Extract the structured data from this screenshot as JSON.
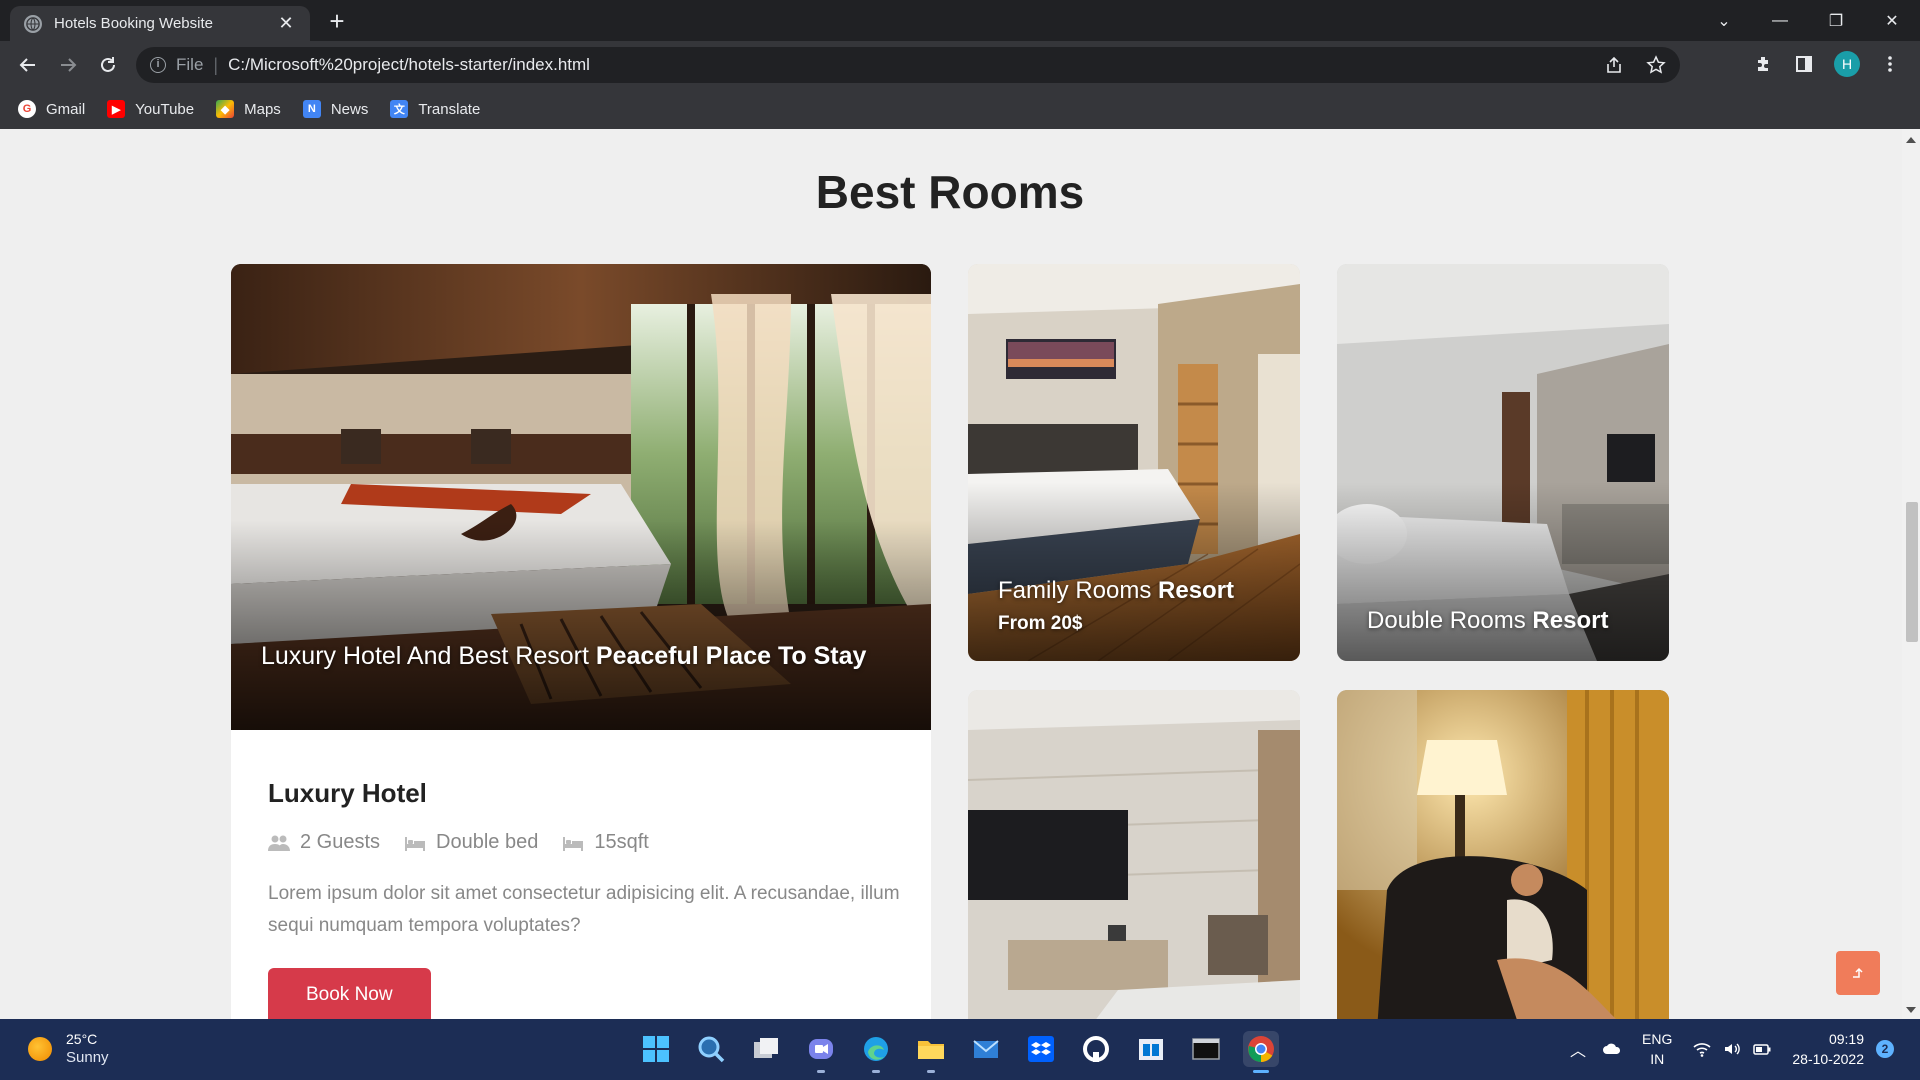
{
  "browser": {
    "tab_title": "Hotels Booking Website",
    "new_tab_label": "+",
    "scheme_label": "File",
    "url": "C:/Microsoft%20project/hotels-starter/index.html",
    "profile_initial": "H",
    "bookmarks": [
      {
        "label": "Gmail",
        "icon": "gmail-icon",
        "color": "#ea4335"
      },
      {
        "label": "YouTube",
        "icon": "youtube-icon",
        "color": "#ff0000"
      },
      {
        "label": "Maps",
        "icon": "maps-icon",
        "color": "#34a853"
      },
      {
        "label": "News",
        "icon": "news-icon",
        "color": "#4285f4"
      },
      {
        "label": "Translate",
        "icon": "translate-icon",
        "color": "#4285f4"
      }
    ]
  },
  "page": {
    "section_title": "Best Rooms",
    "featured": {
      "image_caption_plain": "Luxury Hotel And Best Resort ",
      "image_caption_bold": "Peaceful Place To Stay",
      "title": "Luxury Hotel",
      "meta": {
        "guests": "2 Guests",
        "bed": "Double bed",
        "size": "15sqft"
      },
      "description": "Lorem ipsum dolor sit amet consectetur adipisicing elit. A recusandae, illum sequi numquam tempora voluptates?",
      "button_label": "Book Now"
    },
    "rooms": [
      {
        "title_plain": "Family Rooms ",
        "title_bold": "Resort",
        "price": "From 20$"
      },
      {
        "title_plain": "Double Rooms ",
        "title_bold": "Resort"
      }
    ]
  },
  "taskbar": {
    "temperature": "25°C",
    "condition": "Sunny",
    "lang_top": "ENG",
    "lang_bottom": "IN",
    "time": "09:19",
    "date": "28-10-2022",
    "notification_count": "2"
  },
  "colors": {
    "accent_button": "#d63a4a",
    "scroll_top_button": "#f07c5a",
    "taskbar": "#1c2d55"
  }
}
